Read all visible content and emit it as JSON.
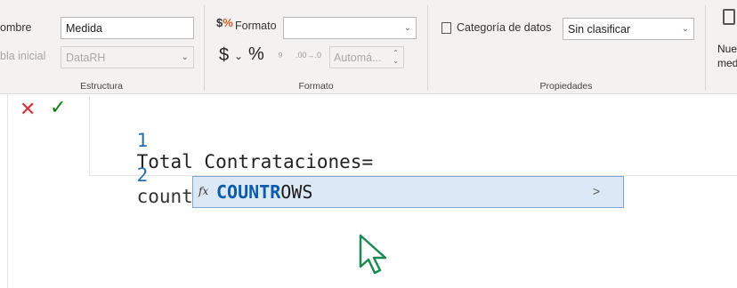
{
  "ribbon": {
    "structure": {
      "name_label": "ombre",
      "name_value": "Medida",
      "home_table_label": "bla inicial",
      "home_table_value": "DataRH",
      "group_label": "Estructura"
    },
    "format": {
      "format_label": "Formato",
      "format_value": "",
      "currency_symbol": "$",
      "dropdown_chevron": "⌄",
      "percent_symbol": "%",
      "comma_symbol": "⁹",
      "decimal_symbol": ".00→.0",
      "decimals_value": "Automá...",
      "group_label": "Formato"
    },
    "properties": {
      "category_label": "Categoría de datos",
      "category_value": "Sin clasificar",
      "group_label": "Propiedades"
    },
    "new_measure": {
      "line1": "Nue",
      "line2": "med"
    }
  },
  "formula_bar": {
    "cancel_symbol": "✕",
    "commit_symbol": "✓",
    "lines": [
      {
        "number": "1",
        "code": "Total Contrataciones="
      },
      {
        "number": "2",
        "code": "countr"
      }
    ]
  },
  "autocomplete": {
    "icon_label": "fx",
    "item_matched": "COUNTR",
    "item_rest": "OWS",
    "arrow": ">"
  },
  "colors": {
    "accent": "#0b5cad",
    "cancel": "#d13438",
    "commit": "#107c10",
    "selection_bg": "#dce8f6"
  }
}
